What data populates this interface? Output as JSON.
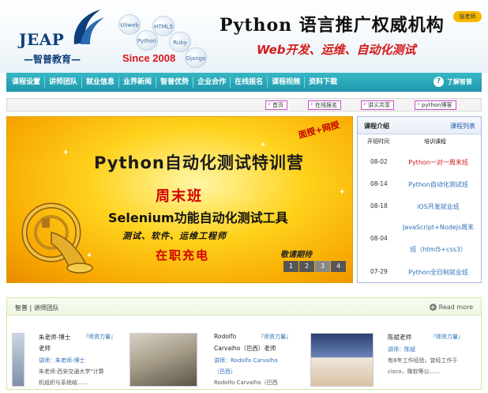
{
  "brand": {
    "logo_text": "JEAP",
    "logo_cn": "—智普教育—",
    "since": "Since 2008",
    "tech_bubbles": [
      "Uliweb",
      "HTML5",
      "Python",
      "Ruby",
      "Django"
    ],
    "slogan_main": "Python 语言推广权威机构",
    "slogan_sub": "Web开发、运维、自动化测试",
    "teacher_badge": "张老师"
  },
  "nav": {
    "items": [
      "课程设置",
      "讲师团队",
      "就业信息",
      "业界新闻",
      "智普优势",
      "企业合作",
      "在线报名",
      "课程视频",
      "资料下载"
    ],
    "help_label": "了解智普"
  },
  "quick_links": [
    "首页",
    "在线报名",
    "讲义共享",
    "python博客"
  ],
  "banner": {
    "line1": "Python自动化测试特训营",
    "line2": "周末班",
    "line3": "Selenium功能自动化测试工具",
    "line4": "测试、软件、运维工程师",
    "line5": "在职充电",
    "stamp": "面授+网授",
    "stay": "敬请期待",
    "pages": [
      "1",
      "2",
      "3",
      "4"
    ],
    "active_page": "3"
  },
  "courses": {
    "title": "课程介绍",
    "more": "课程列表",
    "col_date": "开班时间",
    "col_name": "培训课程",
    "rows": [
      {
        "date": "08-02",
        "name": "Python一对一周末班",
        "color": "red"
      },
      {
        "date": "08-14",
        "name": "Python自动化测试班",
        "color": "blue"
      },
      {
        "date": "08-18",
        "name": "iOS开发就业班",
        "color": "blue"
      },
      {
        "date": "08-04",
        "name1": "JavaScript+Nodejs周末",
        "name2": "班（html5+css3）",
        "color": "blue"
      },
      {
        "date": "07-29",
        "name": "Python全日制就业班",
        "color": "blue"
      }
    ]
  },
  "teachers": {
    "title": "智普 | 讲师团队",
    "more": "Read more",
    "list": [
      {
        "name": "朱老师-博士",
        "role": "老师",
        "tag": "『师资力量』",
        "by": "讲师：朱老师-博士",
        "desc1": "朱老师:西安交通大学\"计算",
        "desc2": "机组织与系统结……"
      },
      {
        "name1": "Rodolfo",
        "name2": "Carvalho（巴西）老师",
        "tag": "『师资力量』",
        "by1": "讲师：Rodolfo Carvalho",
        "by2": "（巴西）",
        "desc1": "Rodolfo Carvalho（巴西"
      },
      {
        "name": "陈斌老师",
        "tag": "『师资力量』",
        "by": "讲师：陈斌",
        "desc1": "有8年工作经验，曾经工作于",
        "desc2": "cisco，微软等公……"
      }
    ]
  }
}
